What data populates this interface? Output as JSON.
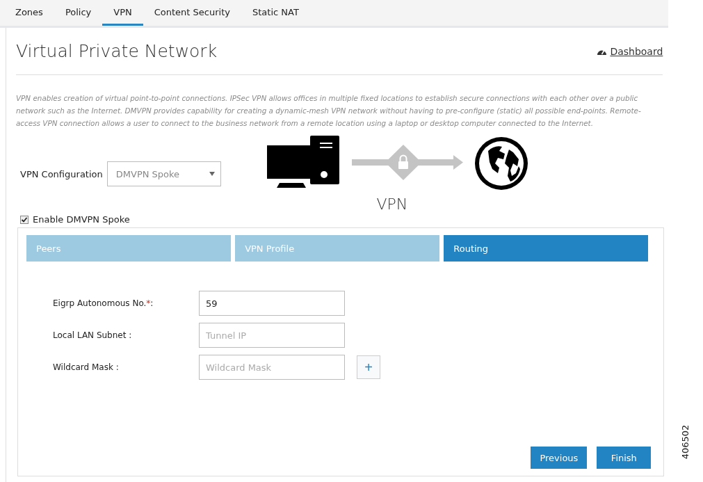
{
  "nav_tabs": [
    {
      "label": "Zones",
      "selected": false
    },
    {
      "label": "Policy",
      "selected": false
    },
    {
      "label": "VPN",
      "selected": true
    },
    {
      "label": "Content Security",
      "selected": false
    },
    {
      "label": "Static NAT",
      "selected": false
    }
  ],
  "page_title": "Virtual Private Network",
  "dashboard_link": "Dashboard",
  "description": "VPN enables creation of virtual point-to-point connections. IPSec VPN allows offices in multiple fixed locations to establish secure connections with each other over a public network such as the Internet. DMVPN provides capability for creating a dynamic-mesh VPN network without having to pre-configure (static) all possible end-points. Remote-access VPN connection allows a user to connect to the business network from a remote location using a laptop or desktop computer connected to the Internet.",
  "vpn_configuration": {
    "label": "VPN Configuration",
    "value": "DMVPN Spoke"
  },
  "diagram": {
    "label": "VPN"
  },
  "enable_checkbox": {
    "label": "Enable DMVPN Spoke",
    "checked": true
  },
  "wizard_steps": [
    {
      "label": "Peers",
      "selected": false
    },
    {
      "label": "VPN Profile",
      "selected": false
    },
    {
      "label": "Routing",
      "selected": true
    }
  ],
  "fields": [
    {
      "label": "Eigrp Autonomous No.",
      "required_mark": "*",
      "colon": ":",
      "value": "59"
    },
    {
      "label": "Local LAN Subnet :",
      "placeholder": "Tunnel IP"
    },
    {
      "label": "Wildcard Mask :",
      "placeholder": "Wildcard Mask",
      "add_label": "+"
    }
  ],
  "buttons": [
    "Previous",
    "Finish"
  ],
  "figure_id": "406502"
}
